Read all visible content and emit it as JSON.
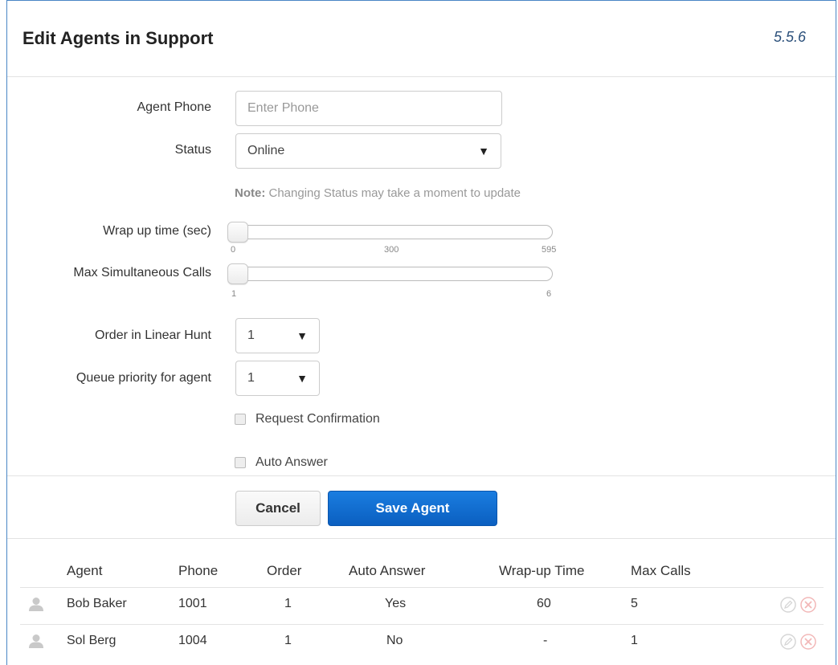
{
  "header": {
    "title": "Edit Agents in Support",
    "version": "5.5.6"
  },
  "form": {
    "agent_phone": {
      "label": "Agent Phone",
      "placeholder": "Enter Phone",
      "value": ""
    },
    "status": {
      "label": "Status",
      "value": "Online"
    },
    "note": {
      "prefix": "Note:",
      "text": " Changing Status may take a moment to update"
    },
    "wrap_up": {
      "label": "Wrap up time (sec)",
      "value": 0,
      "ticks": [
        "0",
        "300",
        "595"
      ]
    },
    "max_calls": {
      "label": "Max Simultaneous Calls",
      "value": 1,
      "ticks": [
        "1",
        "6"
      ]
    },
    "order": {
      "label": "Order in Linear Hunt",
      "value": "1"
    },
    "queue_priority": {
      "label": "Queue priority for agent",
      "value": "1"
    },
    "request_confirmation": {
      "label": "Request Confirmation",
      "checked": false
    },
    "auto_answer": {
      "label": "Auto Answer",
      "checked": false
    }
  },
  "buttons": {
    "cancel": "Cancel",
    "save": "Save Agent"
  },
  "table": {
    "headers": [
      "Agent",
      "Phone",
      "Order",
      "Auto Answer",
      "Wrap-up Time",
      "Max Calls"
    ],
    "rows": [
      {
        "agent": "Bob Baker",
        "phone": "1001",
        "order": "1",
        "auto_answer": "Yes",
        "wrap_up": "60",
        "max_calls": "5"
      },
      {
        "agent": "Sol Berg",
        "phone": "1004",
        "order": "1",
        "auto_answer": "No",
        "wrap_up": "-",
        "max_calls": "1"
      }
    ]
  },
  "colors": {
    "accent": "#0b6fd1",
    "frame": "#4a86c5"
  },
  "icons": [
    "user-avatar-icon",
    "edit-icon",
    "delete-icon",
    "dropdown-arrow-icon"
  ]
}
